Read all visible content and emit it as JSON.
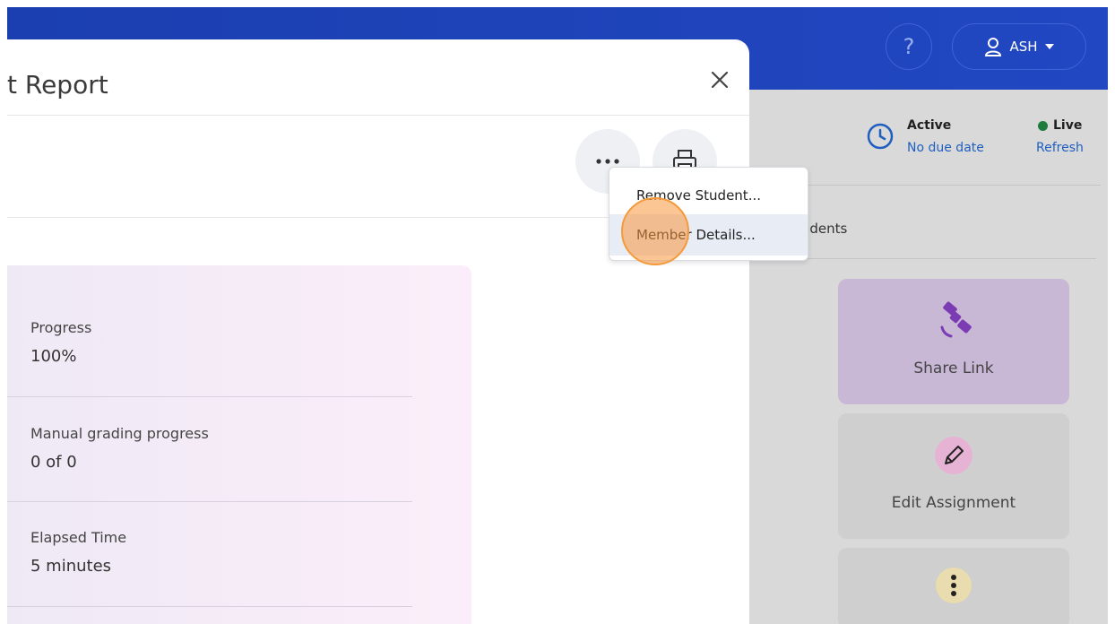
{
  "header": {
    "help_label": "?",
    "user_label": "ASH"
  },
  "assignment_status": {
    "state": "Active",
    "due": "No due date",
    "live": "Live",
    "refresh": "Refresh",
    "students_tab": "tudents"
  },
  "actions": {
    "share_link": "Share Link",
    "edit_assignment": "Edit Assignment"
  },
  "modal": {
    "title": "t Report",
    "stats": [
      {
        "label": "Progress",
        "value": "100%"
      },
      {
        "label": "Manual grading progress",
        "value": "0 of 0"
      },
      {
        "label": "Elapsed Time",
        "value": "5 minutes"
      }
    ]
  },
  "menu": {
    "items": [
      "Remove Student...",
      "Member Details..."
    ]
  },
  "colors": {
    "topbar": "#1b3fb0",
    "accent_blue": "#1f5fbf",
    "live_green": "#1e7d3c",
    "click_marker": "#f39a3d"
  }
}
